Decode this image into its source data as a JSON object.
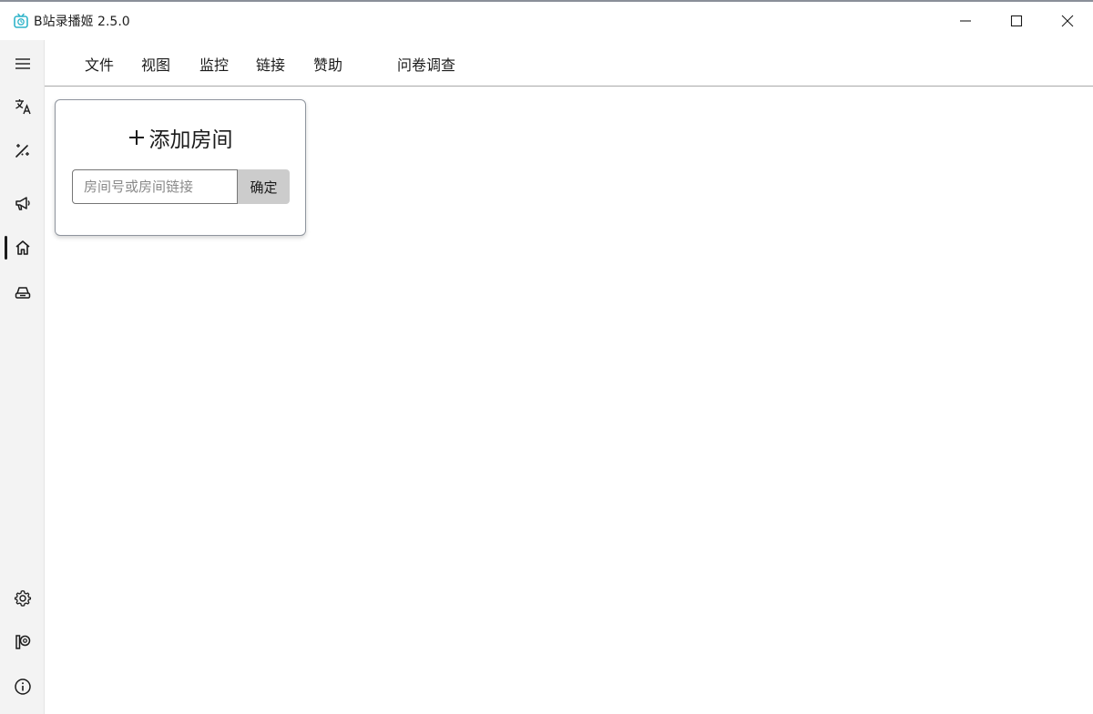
{
  "window": {
    "title": "B站录播姬 2.5.0",
    "controls": {
      "minimize": "minimize-icon",
      "maximize": "maximize-icon",
      "close": "close-icon"
    }
  },
  "sidebar": {
    "items": [
      {
        "icon": "menu-icon",
        "name": "hamburger-menu"
      },
      {
        "icon": "translate-icon",
        "name": "language"
      },
      {
        "icon": "magic-wand-icon",
        "name": "toolbox"
      },
      {
        "icon": "megaphone-icon",
        "name": "announcement"
      },
      {
        "icon": "home-icon",
        "name": "home",
        "active": true
      },
      {
        "icon": "archive-icon",
        "name": "logs"
      },
      {
        "icon": "gear-icon",
        "name": "settings"
      },
      {
        "icon": "patreon-icon",
        "name": "sponsor"
      },
      {
        "icon": "info-icon",
        "name": "about"
      }
    ]
  },
  "menubar": {
    "file": "文件",
    "view": "视图",
    "monitor": "监控",
    "links": "链接",
    "sponsor": "赞助",
    "survey": "问卷调查"
  },
  "add_room": {
    "title": "添加房间",
    "input_placeholder": "房间号或房间链接",
    "input_value": "",
    "confirm_label": "确定"
  },
  "colors": {
    "sidebar_bg": "#f3f3f3",
    "confirm_bg": "#cccccc",
    "app_icon": "#2fb4c9"
  }
}
